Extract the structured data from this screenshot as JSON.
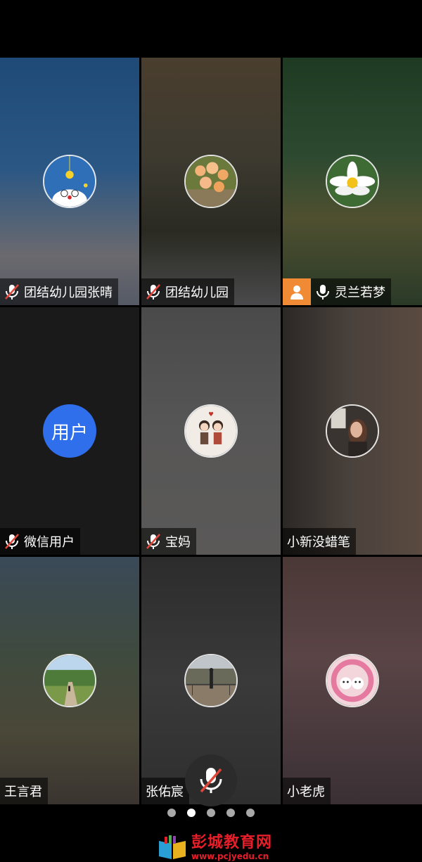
{
  "participants": [
    {
      "name": "团结幼儿园张晴",
      "mic": "muted",
      "avatar": "doraemon-avatar"
    },
    {
      "name": "团结幼儿园",
      "mic": "muted",
      "avatar": "flower-bush-avatar"
    },
    {
      "name": "灵兰若梦",
      "mic": "on",
      "host": true,
      "avatar": "lotus-avatar"
    },
    {
      "name": "微信用户",
      "mic": "muted",
      "avatar_text": "用户"
    },
    {
      "name": "宝妈",
      "mic": "muted",
      "avatar": "cartoon-couple-avatar"
    },
    {
      "name": "小新没蜡笔",
      "mic": "none",
      "avatar": "portrait-avatar"
    },
    {
      "name": "王言君",
      "mic": "none",
      "avatar": "park-path-avatar"
    },
    {
      "name": "张佑宸",
      "mic": "none",
      "avatar": "bridge-photo-avatar"
    },
    {
      "name": "小老虎",
      "mic": "none",
      "avatar": "puppies-wreath-avatar"
    }
  ],
  "pager": {
    "count": 5,
    "active_index": 1
  },
  "controls": {
    "mic_button": "mic-muted-icon"
  },
  "watermark": {
    "title": "彭城教育网",
    "url": "www.pcjyedu.cn"
  },
  "colors": {
    "host_badge": "#f08a34",
    "text_avatar": "#2f6fec",
    "muted_slash": "#e0463a",
    "watermark": "#e61e2a"
  }
}
